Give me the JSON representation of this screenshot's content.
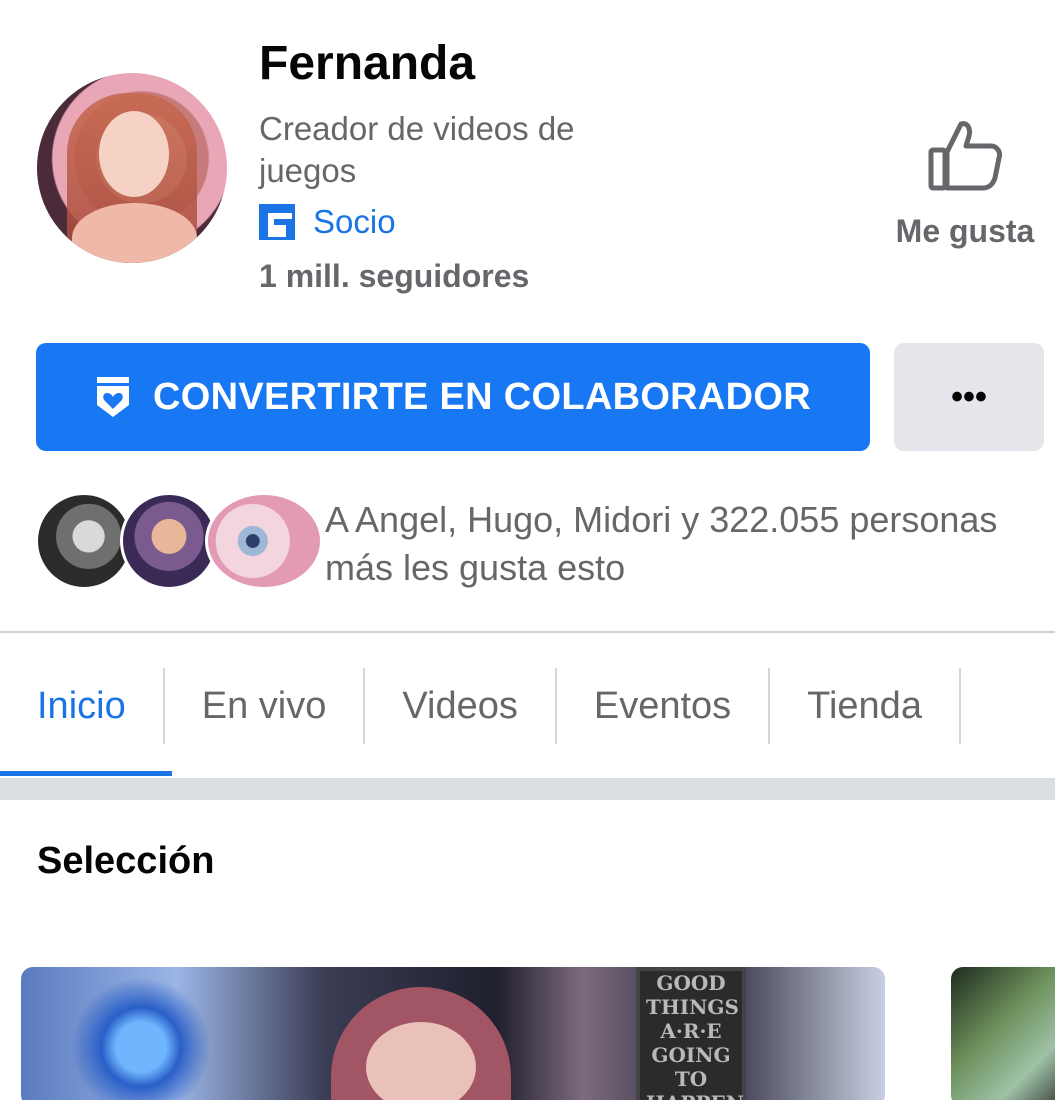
{
  "profile": {
    "name": "Fernanda",
    "category": "Creador de videos de juegos",
    "partner_label": "Socio",
    "followers": "1 mill. seguidores"
  },
  "like": {
    "label": "Me gusta"
  },
  "actions": {
    "primary_label": "CONVERTIRTE EN COLABORADOR",
    "more_label": "•••"
  },
  "social": {
    "likes_text": "A Angel, Hugo, Midori y 322.055 personas más les gusta esto"
  },
  "tabs": [
    {
      "label": "Inicio",
      "active": true
    },
    {
      "label": "En vivo",
      "active": false
    },
    {
      "label": "Videos",
      "active": false
    },
    {
      "label": "Eventos",
      "active": false
    },
    {
      "label": "Tienda",
      "active": false
    }
  ],
  "section": {
    "title": "Selección"
  },
  "video": {
    "poster_text": "GOOD THINGS A·R·E GOING TO HAPPEN"
  },
  "colors": {
    "accent": "#1877f2",
    "link": "#1b74e4",
    "secondary_text": "#65676b"
  }
}
